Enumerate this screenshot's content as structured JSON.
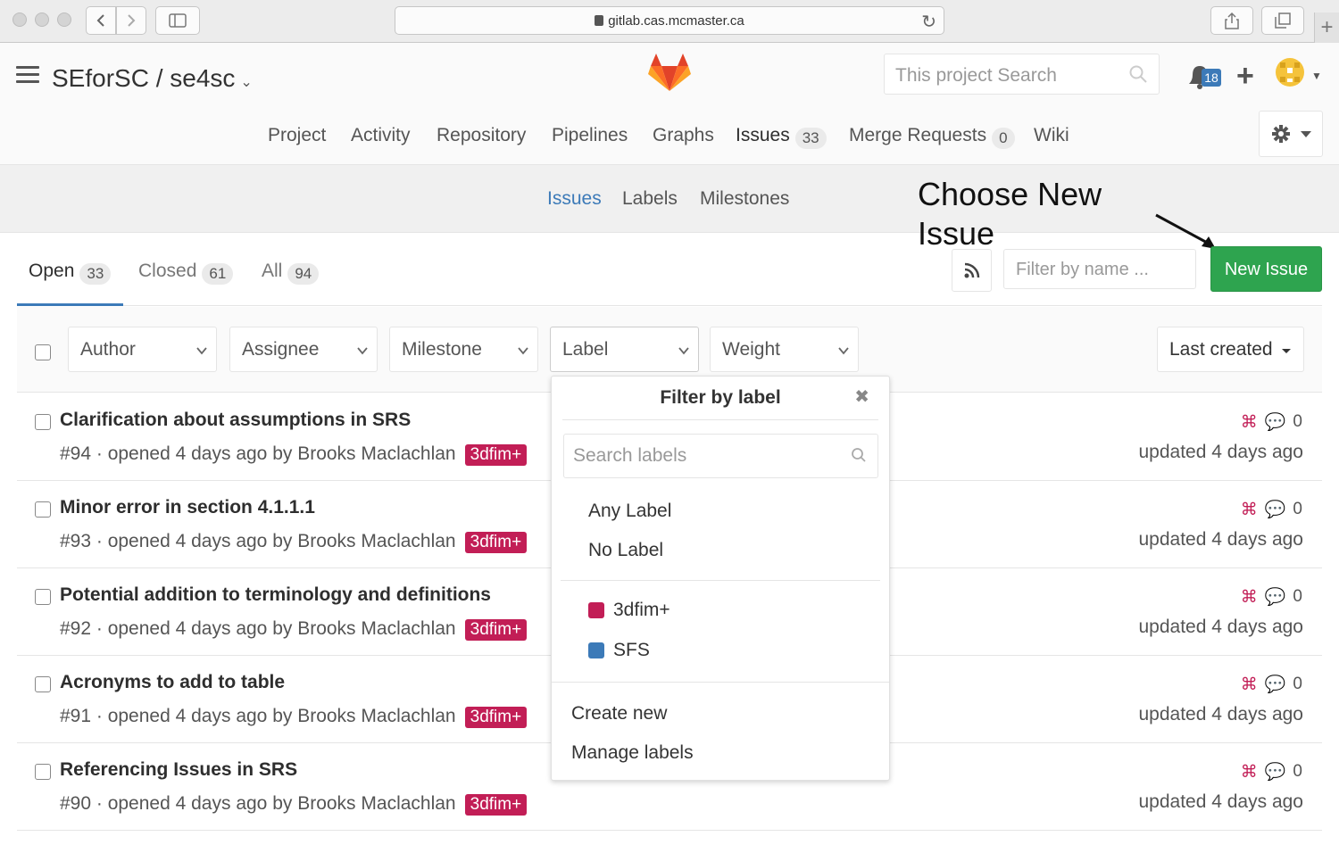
{
  "browser": {
    "url": "gitlab.cas.mcmaster.ca"
  },
  "header": {
    "project_title": "SEforSC / se4sc",
    "search_placeholder": "This project Search",
    "notification_count": "18"
  },
  "nav": {
    "items": [
      {
        "label": "Project"
      },
      {
        "label": "Activity"
      },
      {
        "label": "Repository"
      },
      {
        "label": "Pipelines"
      },
      {
        "label": "Graphs"
      },
      {
        "label": "Issues",
        "count": "33"
      },
      {
        "label": "Merge Requests",
        "count": "0"
      },
      {
        "label": "Wiki"
      }
    ]
  },
  "subnav": {
    "items": [
      "Issues",
      "Labels",
      "Milestones"
    ]
  },
  "annotation": {
    "text_line1": "Choose New",
    "text_line2": "Issue"
  },
  "issue_tabs": [
    {
      "label": "Open",
      "count": "33"
    },
    {
      "label": "Closed",
      "count": "61"
    },
    {
      "label": "All",
      "count": "94"
    }
  ],
  "toolbar": {
    "filter_placeholder": "Filter by name ...",
    "new_issue_label": "New Issue"
  },
  "filters": {
    "dropdowns": [
      "Author",
      "Assignee",
      "Milestone",
      "Label",
      "Weight"
    ],
    "sort_label": "Last created"
  },
  "issues": [
    {
      "title": "Clarification about assumptions in SRS",
      "meta": "#94 · opened 4 days ago by Brooks Maclachlan",
      "label": "3dfim+",
      "comments": "0",
      "updated": "updated 4 days ago"
    },
    {
      "title": "Minor error in section 4.1.1.1",
      "meta": "#93 · opened 4 days ago by Brooks Maclachlan",
      "label": "3dfim+",
      "comments": "0",
      "updated": "updated 4 days ago"
    },
    {
      "title": "Potential addition to terminology and definitions",
      "meta": "#92 · opened 4 days ago by Brooks Maclachlan",
      "label": "3dfim+",
      "comments": "0",
      "updated": "updated 4 days ago"
    },
    {
      "title": "Acronyms to add to table",
      "meta": "#91 · opened 4 days ago by Brooks Maclachlan",
      "label": "3dfim+",
      "comments": "0",
      "updated": "updated 4 days ago"
    },
    {
      "title": "Referencing Issues in SRS",
      "meta": "#90 · opened 4 days ago by Brooks Maclachlan",
      "label": "3dfim+",
      "comments": "0",
      "updated": "updated 4 days ago"
    }
  ],
  "label_menu": {
    "title": "Filter by label",
    "search_placeholder": "Search labels",
    "special": [
      "Any Label",
      "No Label"
    ],
    "labels": [
      {
        "name": "3dfim+",
        "color": "#c21e56"
      },
      {
        "name": "SFS",
        "color": "#3c7ab8"
      }
    ],
    "footer": [
      "Create new",
      "Manage labels"
    ]
  },
  "colors": {
    "accent": "#3c7ab8",
    "success": "#2ea44f",
    "label_3dfim": "#c21e56"
  }
}
